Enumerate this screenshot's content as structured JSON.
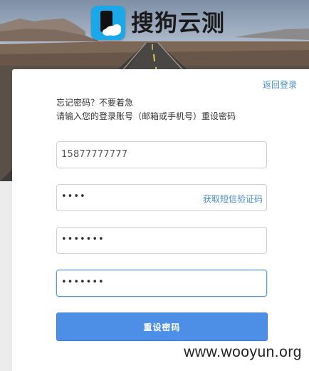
{
  "logo": {
    "name": "搜狗云测"
  },
  "card": {
    "back_login": "返回登录",
    "intro_line1": "忘记密码？不要着急",
    "intro_line2": "请输入您的登录账号（邮箱或手机号）重设密码"
  },
  "form": {
    "account_value": "15877777777",
    "code_mask": "••••",
    "sms_link": "获取短信验证码",
    "password_mask": "•••••••",
    "confirm_mask": "•••••••",
    "submit_label": "重设密码"
  },
  "watermark": "www.wooyun.org",
  "colors": {
    "accent": "#4d8fe6",
    "link": "#4a8bc9",
    "logo_bg": "#1aa8e8"
  }
}
